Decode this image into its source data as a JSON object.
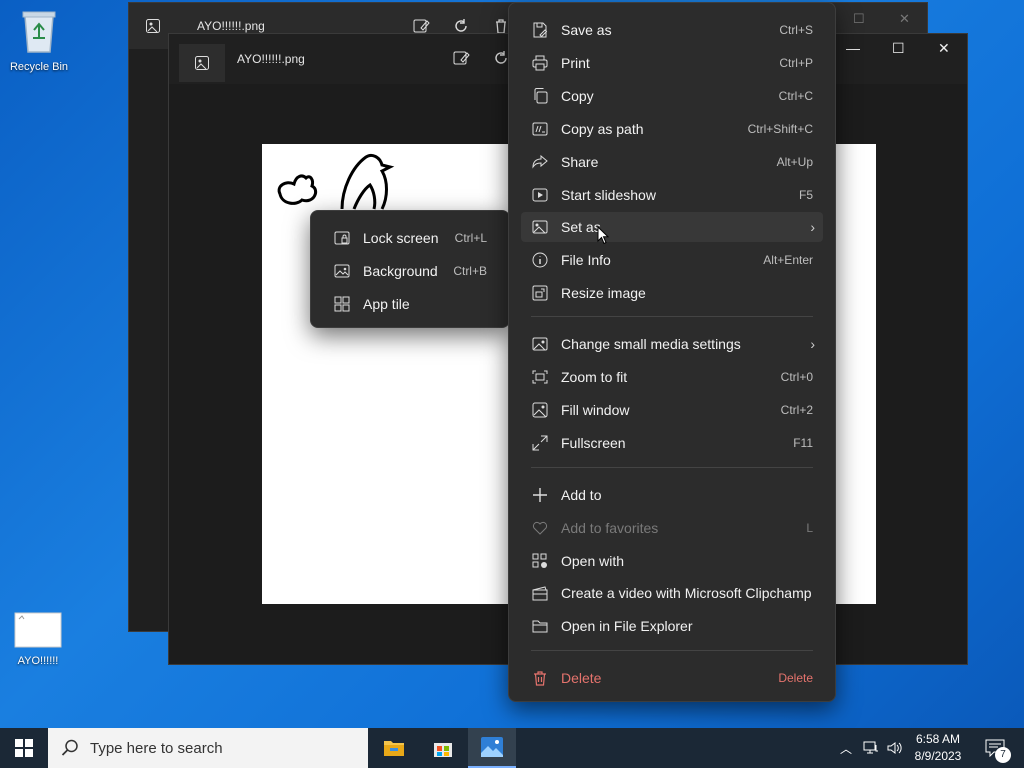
{
  "desktop": {
    "recycle_bin_label": "Recycle Bin",
    "file_label": "AYO!!!!!!"
  },
  "back_window": {
    "title": "AYO!!!!!!.png"
  },
  "front_window": {
    "title": "AYO!!!!!!.png"
  },
  "context_menu": {
    "items": [
      {
        "label": "Save as",
        "shortcut": "Ctrl+S",
        "icon": "save-as-icon"
      },
      {
        "label": "Print",
        "shortcut": "Ctrl+P",
        "icon": "print-icon"
      },
      {
        "label": "Copy",
        "shortcut": "Ctrl+C",
        "icon": "copy-icon"
      },
      {
        "label": "Copy as path",
        "shortcut": "Ctrl+Shift+C",
        "icon": "copy-path-icon"
      },
      {
        "label": "Share",
        "shortcut": "Alt+Up",
        "icon": "share-icon"
      },
      {
        "label": "Start slideshow",
        "shortcut": "F5",
        "icon": "slideshow-icon"
      },
      {
        "label": "Set as",
        "shortcut": "",
        "icon": "set-as-icon"
      },
      {
        "label": "File Info",
        "shortcut": "Alt+Enter",
        "icon": "info-icon"
      },
      {
        "label": "Resize image",
        "shortcut": "",
        "icon": "resize-icon"
      },
      {
        "label": "Change small media settings",
        "shortcut": "",
        "icon": "media-settings-icon"
      },
      {
        "label": "Zoom to fit",
        "shortcut": "Ctrl+0",
        "icon": "zoom-fit-icon"
      },
      {
        "label": "Fill window",
        "shortcut": "Ctrl+2",
        "icon": "fill-window-icon"
      },
      {
        "label": "Fullscreen",
        "shortcut": "F11",
        "icon": "fullscreen-icon"
      },
      {
        "label": "Add to",
        "shortcut": "",
        "icon": "plus-icon"
      },
      {
        "label": "Add to favorites",
        "shortcut": "L",
        "icon": "heart-icon"
      },
      {
        "label": "Open with",
        "shortcut": "",
        "icon": "open-with-icon"
      },
      {
        "label": "Create a video with Microsoft Clipchamp",
        "shortcut": "",
        "icon": "clipchamp-icon"
      },
      {
        "label": "Open in File Explorer",
        "shortcut": "",
        "icon": "folder-icon"
      },
      {
        "label": "Delete",
        "shortcut": "Delete",
        "icon": "trash-icon"
      }
    ]
  },
  "submenu": {
    "items": [
      {
        "label": "Lock screen",
        "shortcut": "Ctrl+L",
        "icon": "lock-screen-icon"
      },
      {
        "label": "Background",
        "shortcut": "Ctrl+B",
        "icon": "background-icon"
      },
      {
        "label": "App tile",
        "shortcut": "",
        "icon": "app-tile-icon"
      }
    ]
  },
  "taskbar": {
    "search_placeholder": "Type here to search",
    "time": "6:58 AM",
    "date": "8/9/2023",
    "notification_count": "7"
  },
  "colors": {
    "accent": "#0a63c9",
    "menu_bg": "#2c2c2c",
    "danger": "#e5736d"
  }
}
